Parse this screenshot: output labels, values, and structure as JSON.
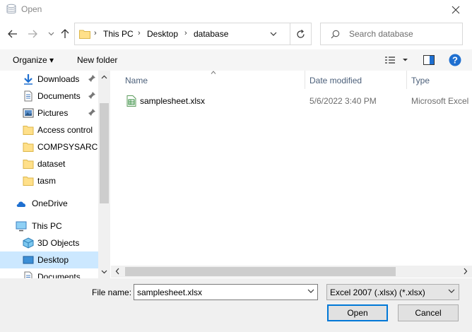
{
  "window": {
    "title": "Open",
    "close_icon": "close-icon"
  },
  "nav": {
    "back_icon": "arrow-left-icon",
    "forward_icon": "arrow-right-icon",
    "recent_icon": "chevron-down-icon",
    "up_icon": "arrow-up-icon"
  },
  "address": {
    "crumbs": [
      "This PC",
      "Desktop",
      "database"
    ],
    "dropdown_icon": "chevron-down-icon",
    "refresh_icon": "refresh-icon"
  },
  "search": {
    "placeholder": "Search database",
    "icon": "search-icon"
  },
  "toolbar": {
    "organize_label": "Organize ▾",
    "new_folder_label": "New folder",
    "view_icon": "details-view-icon",
    "preview_icon": "preview-pane-icon",
    "help_icon": "help-icon",
    "help_label": "?"
  },
  "sidebar": {
    "items": [
      {
        "label": "Downloads",
        "icon": "download-icon",
        "pinned": true
      },
      {
        "label": "Documents",
        "icon": "document-icon",
        "pinned": true
      },
      {
        "label": "Pictures",
        "icon": "picture-icon",
        "pinned": true
      },
      {
        "label": "Access control",
        "icon": "folder-icon"
      },
      {
        "label": "COMPSYSARCH",
        "icon": "folder-icon"
      },
      {
        "label": "dataset",
        "icon": "folder-icon"
      },
      {
        "label": "tasm",
        "icon": "folder-icon"
      },
      {
        "label": "OneDrive",
        "icon": "cloud-icon"
      },
      {
        "label": "This PC",
        "icon": "computer-icon"
      },
      {
        "label": "3D Objects",
        "icon": "cube-icon"
      },
      {
        "label": "Desktop",
        "icon": "desktop-icon",
        "selected": true
      },
      {
        "label": "Documents",
        "icon": "document-icon"
      }
    ]
  },
  "filelist": {
    "columns": [
      "Name",
      "Date modified",
      "Type"
    ],
    "rows": [
      {
        "name": "samplesheet.xlsx",
        "date": "5/6/2022 3:40 PM",
        "type": "Microsoft Excel",
        "icon": "excel-file-icon"
      }
    ]
  },
  "bottom": {
    "filename_label": "File name:",
    "filename_value": "samplesheet.xlsx",
    "filetype_value": "Excel 2007 (.xlsx) (*.xlsx)",
    "open_label": "Open",
    "cancel_label": "Cancel"
  },
  "colors": {
    "selected": "#cce8ff",
    "accent": "#0078d7",
    "folder": "#ffe08a"
  }
}
